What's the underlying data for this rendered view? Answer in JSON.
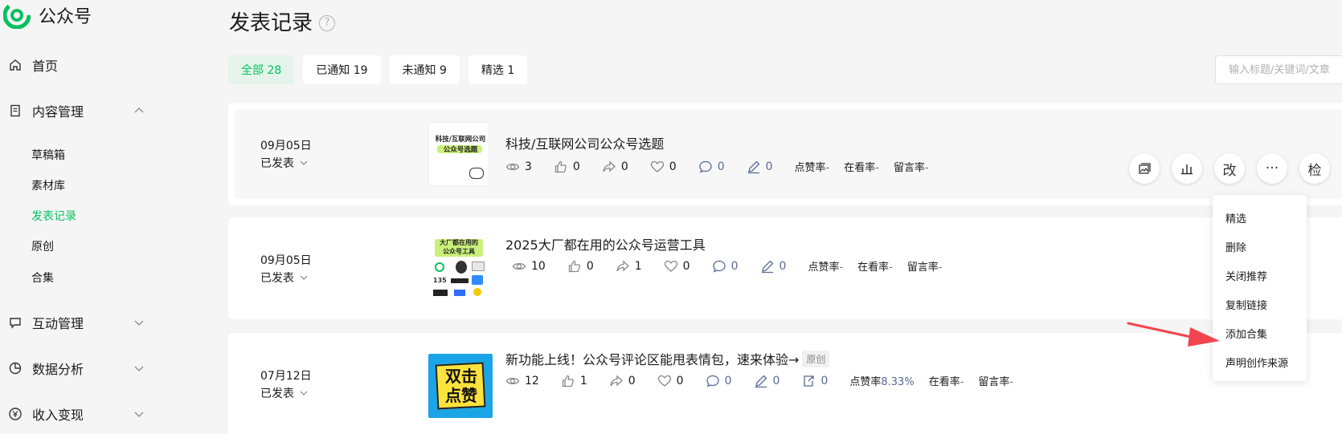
{
  "app": {
    "name": "公众号"
  },
  "sidebar": {
    "items": [
      {
        "label": "首页"
      },
      {
        "label": "内容管理"
      },
      {
        "label": "互动管理"
      },
      {
        "label": "数据分析"
      },
      {
        "label": "收入变现"
      }
    ],
    "sub_items": [
      {
        "label": "草稿箱"
      },
      {
        "label": "素材库"
      },
      {
        "label": "发表记录"
      },
      {
        "label": "原创"
      },
      {
        "label": "合集"
      }
    ]
  },
  "page": {
    "title": "发表记录",
    "help": "?"
  },
  "filters": [
    {
      "label": "全部 28"
    },
    {
      "label": "已通知 19"
    },
    {
      "label": "未通知 9"
    },
    {
      "label": "精选 1"
    }
  ],
  "search": {
    "placeholder": "输入标题/关键词/文章"
  },
  "articles": [
    {
      "date": "09月05日",
      "status": "已发表",
      "title": "科技/互联网公司公众号选题",
      "thumb_text": [
        "科技/互联网公司",
        "公众号选题"
      ],
      "reads": "3",
      "likes": "0",
      "shares": "0",
      "wows": "0",
      "comments": "0",
      "notes": "0",
      "like_rate_label": "点赞率",
      "like_rate": "-",
      "watch_rate_label": "在看率",
      "watch_rate": "-",
      "comment_rate_label": "留言率",
      "comment_rate": "-"
    },
    {
      "date": "09月05日",
      "status": "已发表",
      "title": "2025大厂都在用的公众号运营工具",
      "thumb_text": [
        "大厂都在用的",
        "公众号工具"
      ],
      "reads": "10",
      "likes": "0",
      "shares": "1",
      "wows": "0",
      "comments": "0",
      "notes": "0",
      "like_rate_label": "点赞率",
      "like_rate": "-",
      "watch_rate_label": "在看率",
      "watch_rate": "-",
      "comment_rate_label": "留言率",
      "comment_rate": "-"
    },
    {
      "date": "07月12日",
      "status": "已发表",
      "title": "新功能上线！公众号评论区能甩表情包，速来体验→",
      "badge": "原创",
      "thumb_text": [
        "双击",
        "点赞"
      ],
      "reads": "12",
      "likes": "1",
      "shares": "0",
      "wows": "0",
      "comments": "0",
      "notes": "0",
      "reposts": "0",
      "like_rate_label": "点赞率",
      "like_rate": "8.33%",
      "watch_rate_label": "在看率",
      "watch_rate": "-",
      "comment_rate_label": "留言率",
      "comment_rate": "-"
    }
  ],
  "actions": {
    "edit_label": "改",
    "more_label": "···",
    "check_label": "检"
  },
  "dropdown": [
    {
      "label": "精选"
    },
    {
      "label": "删除"
    },
    {
      "label": "关闭推荐"
    },
    {
      "label": "复制链接"
    },
    {
      "label": "添加合集"
    },
    {
      "label": "声明创作来源"
    }
  ],
  "colors": {
    "accent": "#07c160",
    "link": "#576b95",
    "arrow": "#f2454f"
  }
}
